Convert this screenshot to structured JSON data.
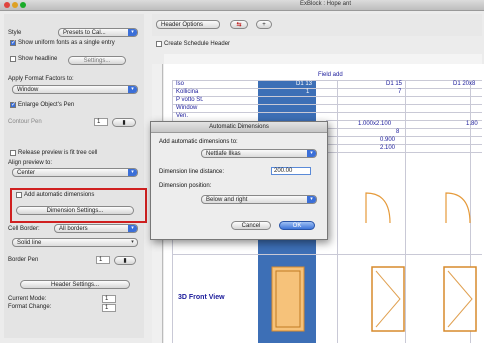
{
  "window": {
    "title": "ExBlock : Hope ant",
    "tabs": [
      "Header Options"
    ]
  },
  "left_panel": {
    "style_label": "Style",
    "style_value": "Presets to Cal...",
    "uniform_fonts_label": "Show uniform fonts as a single entry",
    "headline_label": "Show headline",
    "settings_button": "Settings...",
    "apply_format_label": "Apply Format Factors to:",
    "apply_format_value": "Window",
    "enlarge_label": "Enlarge Object's Pen",
    "outline_pen_label": "Contour Pen",
    "outline_pen_value": "1",
    "release_preview_label": "Release preview is fit tree cell",
    "align_preview_label": "Align preview to:",
    "align_preview_value": "Center",
    "add_dimensions_label": "Add automatic dimensions",
    "dimension_settings_button": "Dimension Settings...",
    "cell_border_label": "Cell Border:",
    "cell_border_value": "All borders",
    "border_type_value": "Solid line",
    "border_pen_label": "Border Pen",
    "border_pen_value": "1",
    "header_settings_button": "Header Settings...",
    "current_mode_label": "Current Mode:",
    "format_change_label": "Format Change:",
    "format_value_1": "1",
    "format_value_2": "1"
  },
  "toolbar": {
    "header_options": "Header Options",
    "create_header_label": "Create Schedule Header"
  },
  "sheet": {
    "header_label": "Field add",
    "row_labels": [
      "Iso",
      "Kollicina",
      "P votto St.",
      "Window",
      "Ven.",
      "Geschmack",
      "",
      "",
      "",
      "3D Front View"
    ],
    "col_headers": [
      "D1 13",
      "D1 15",
      "D1 20x8"
    ],
    "values_col1": [
      "1",
      "",
      "1.000x2.100",
      "8",
      "0.900",
      "2.100"
    ],
    "values_col2": [
      "7",
      "",
      "1.80",
      "",
      "",
      ""
    ]
  },
  "dialog": {
    "title": "Automatic Dimensions",
    "add_dims_label": "Add automatic dimensions to:",
    "add_dims_value": "Nettlafe Ilkas",
    "distance_label": "Dimension line distance:",
    "distance_value": "200.00",
    "position_label": "Dimension position:",
    "position_value": "Below and right",
    "cancel_button": "Cancel",
    "ok_button": "OK"
  }
}
